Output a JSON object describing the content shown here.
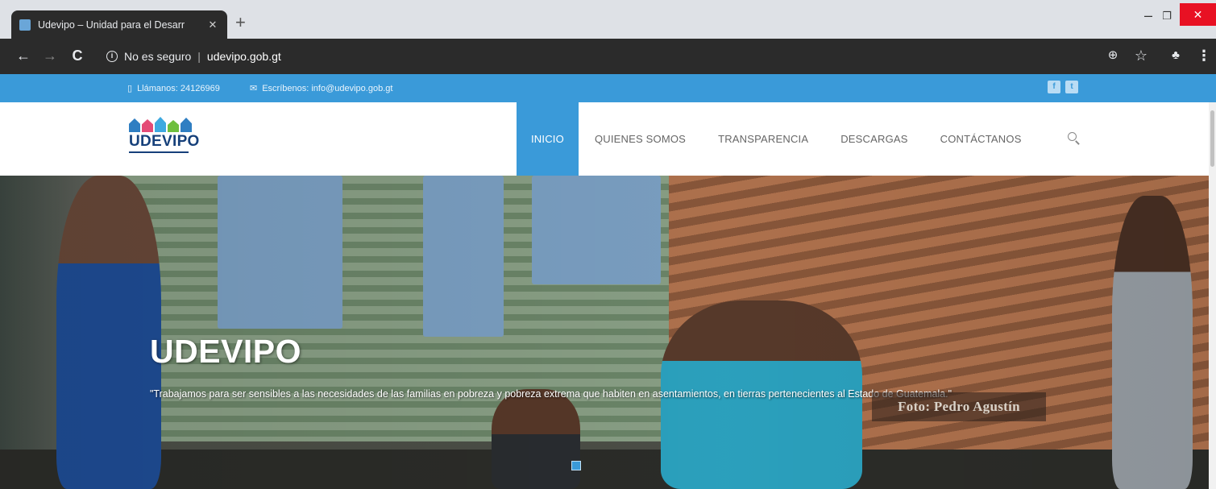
{
  "browser": {
    "tab_title": "Udevipo – Unidad para el Desarr",
    "tab_close": "✕",
    "new_tab": "+",
    "security_label": "No es seguro",
    "url": "udevipo.gob.gt",
    "window_minimize": "–",
    "window_maximize": "❐",
    "window_close": "✕"
  },
  "topbar": {
    "phone": "Llámanos: 24126969",
    "email": "Escríbenos: info@udevipo.gob.gt",
    "social": [
      {
        "name": "facebook",
        "glyph": "f"
      },
      {
        "name": "twitter",
        "glyph": "t"
      }
    ],
    "color": "#3a9ad9"
  },
  "logo": {
    "text": "UDEVIPO"
  },
  "nav": {
    "items": [
      {
        "label": "INICIO",
        "active": true
      },
      {
        "label": "QUIENES SOMOS",
        "active": false
      },
      {
        "label": "TRANSPARENCIA",
        "active": false
      },
      {
        "label": "DESCARGAS",
        "active": false
      },
      {
        "label": "CONTÁCTANOS",
        "active": false
      }
    ],
    "search_icon": "search-icon"
  },
  "hero": {
    "title": "UDEVIPO",
    "text": "\"Trabajamos para ser sensibles a las necesidades de las familias en pobreza y pobreza extrema que habiten en asentamientos, en tierras pertenecientes al Estado de Guatemala.\"",
    "photo_credit": "Foto: Pedro Agustín"
  },
  "colors": {
    "accent": "#3a9ad9",
    "chrome_dark": "#2b2b2b",
    "close_red": "#e81123"
  }
}
